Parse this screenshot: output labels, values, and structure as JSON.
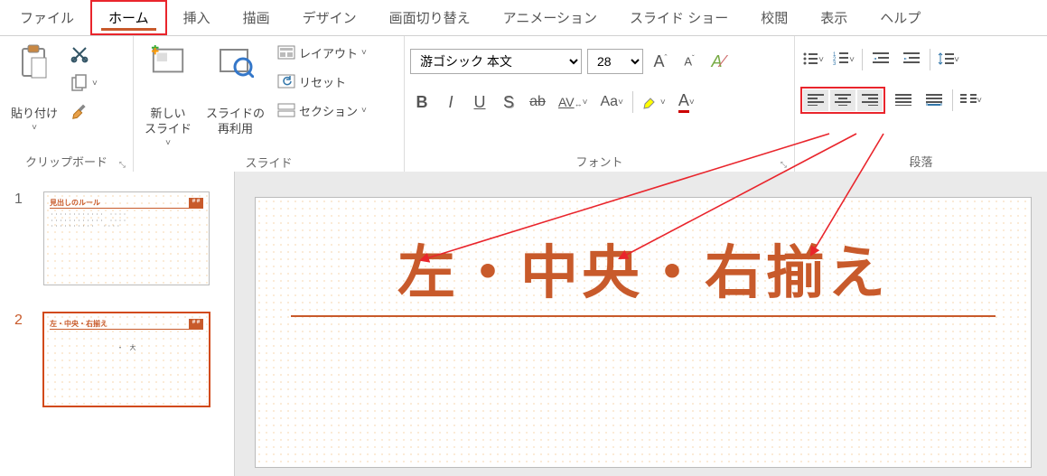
{
  "tabs": {
    "file": "ファイル",
    "home": "ホーム",
    "insert": "挿入",
    "draw": "描画",
    "design": "デザイン",
    "transition": "画面切り替え",
    "animation": "アニメーション",
    "slideshow": "スライド ショー",
    "review": "校閲",
    "view": "表示",
    "help": "ヘルプ"
  },
  "ribbon": {
    "clipboard": {
      "paste": "貼り付け",
      "label": "クリップボード"
    },
    "slides": {
      "new_slide": "新しい\nスライド",
      "reuse": "スライドの\n再利用",
      "layout": "レイアウト",
      "reset": "リセット",
      "section": "セクション",
      "label": "スライド"
    },
    "font": {
      "name_value": "游ゴシック 本文",
      "size_value": "28",
      "label": "フォント"
    },
    "paragraph": {
      "label": "段落"
    }
  },
  "thumbs": {
    "n1": "1",
    "n2": "2",
    "t1_title": "見出しのルール",
    "t2_title": "左・中央・右揃え",
    "tag": "＃＃",
    "t2_body": "・　大"
  },
  "slide": {
    "title": "左・中央・右揃え"
  }
}
